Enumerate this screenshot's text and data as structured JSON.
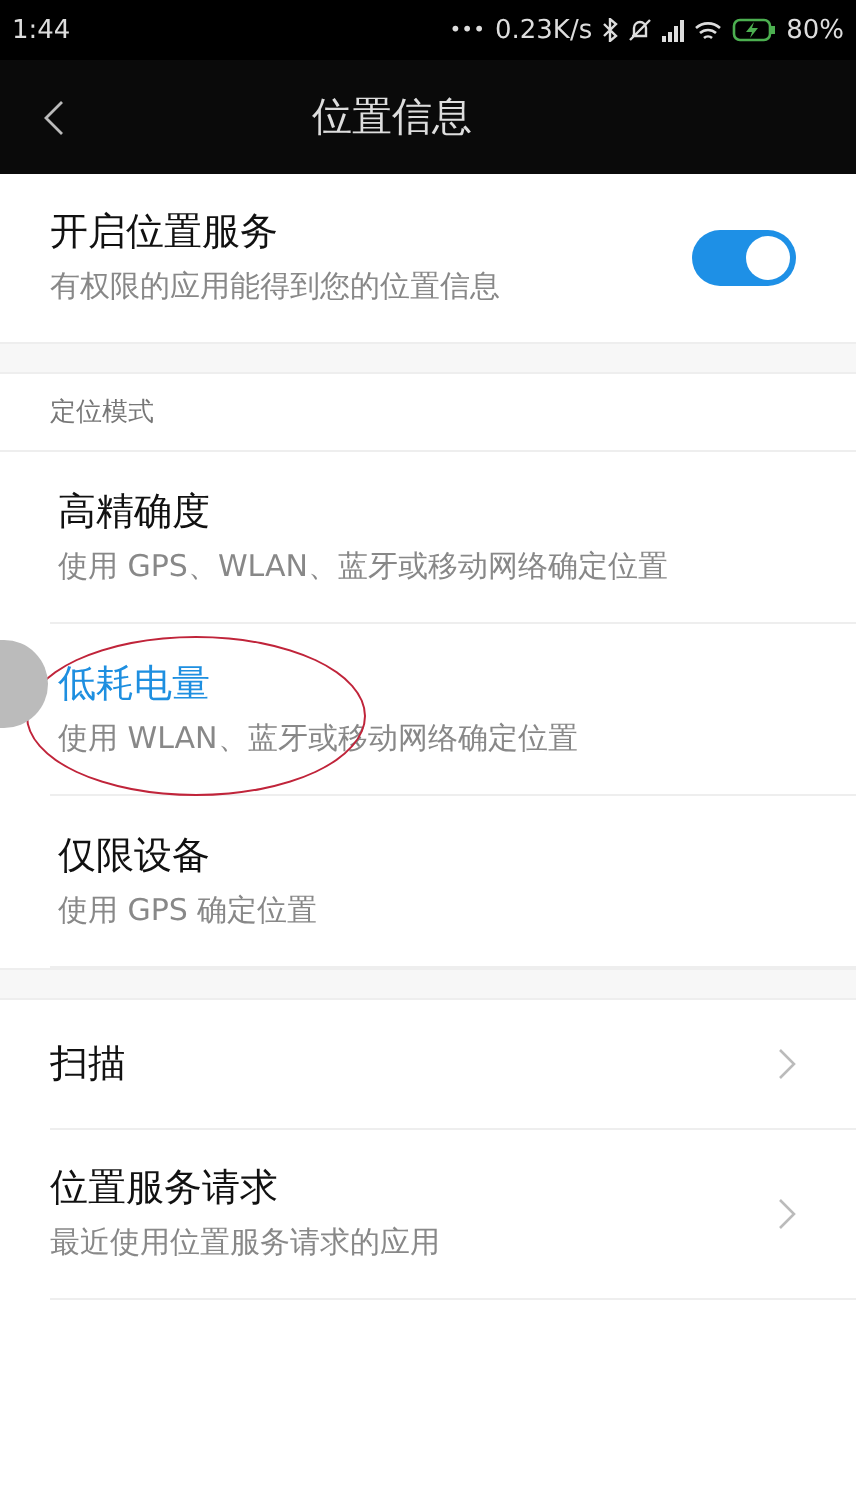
{
  "status_bar": {
    "time": "1:44",
    "dots": "•••",
    "speed": "0.23K/s",
    "battery": "80%"
  },
  "header": {
    "title": "位置信息"
  },
  "service": {
    "title": "开启位置服务",
    "subtitle": "有权限的应用能得到您的位置信息",
    "on": true
  },
  "section_label": "定位模式",
  "modes": [
    {
      "title": "高精确度",
      "subtitle": "使用 GPS、WLAN、蓝牙或移动网络确定位置",
      "selected": false,
      "circled": false
    },
    {
      "title": "低耗电量",
      "subtitle": "使用 WLAN、蓝牙或移动网络确定位置",
      "selected": true,
      "circled": true
    },
    {
      "title": "仅限设备",
      "subtitle": "使用 GPS 确定位置",
      "selected": false,
      "circled": false
    }
  ],
  "links": [
    {
      "title": "扫描"
    },
    {
      "title": "位置服务请求",
      "subtitle": "最近使用位置服务请求的应用"
    }
  ]
}
